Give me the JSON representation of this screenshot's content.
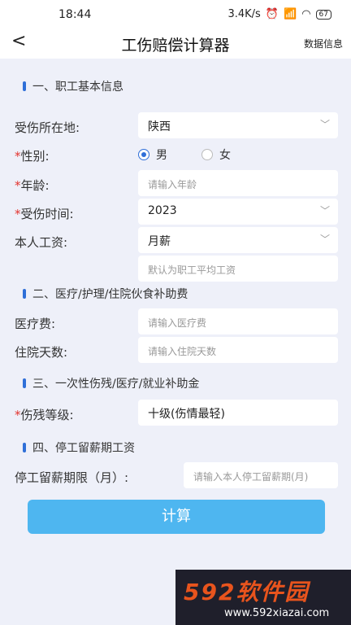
{
  "status": {
    "time": "18:44",
    "net": "3.4K/s",
    "battery": "67"
  },
  "nav": {
    "back": "<",
    "title": "工伤赔偿计算器",
    "data_info": "数据信息"
  },
  "sections": {
    "s1": "一、职工基本信息",
    "s2": "二、医疗/护理/住院伙食补助费",
    "s3": "三、一次性伤残/医疗/就业补助金",
    "s4": "四、停工留薪期工资"
  },
  "form": {
    "location": {
      "label": "受伤所在地:",
      "value": "陕西"
    },
    "gender": {
      "label": "性别:",
      "male": "男",
      "female": "女",
      "selected": "男"
    },
    "age": {
      "label": "年龄:",
      "placeholder": "请输入年龄"
    },
    "injury_time": {
      "label": "受伤时间:",
      "value": "2023"
    },
    "salary": {
      "label": "本人工资:",
      "value": "月薪",
      "placeholder": "默认为职工平均工资"
    },
    "medical": {
      "label": "医疗费:",
      "placeholder": "请输入医疗费"
    },
    "hospital_days": {
      "label": "住院天数:",
      "placeholder": "请输入住院天数"
    },
    "disability": {
      "label": "伤残等级:",
      "value": "十级(伤情最轻)"
    },
    "leave_period": {
      "label": "停工留薪期限（月）:",
      "placeholder": "请输入本人停工留薪期(月)"
    }
  },
  "required_mark": "*",
  "calculate_label": "计算",
  "watermark": {
    "brand": "592软件园",
    "url": "www.592xiazai.com"
  },
  "colors": {
    "accent": "#2f6fd8",
    "button": "#4eb6f0",
    "required": "#e3342f"
  }
}
